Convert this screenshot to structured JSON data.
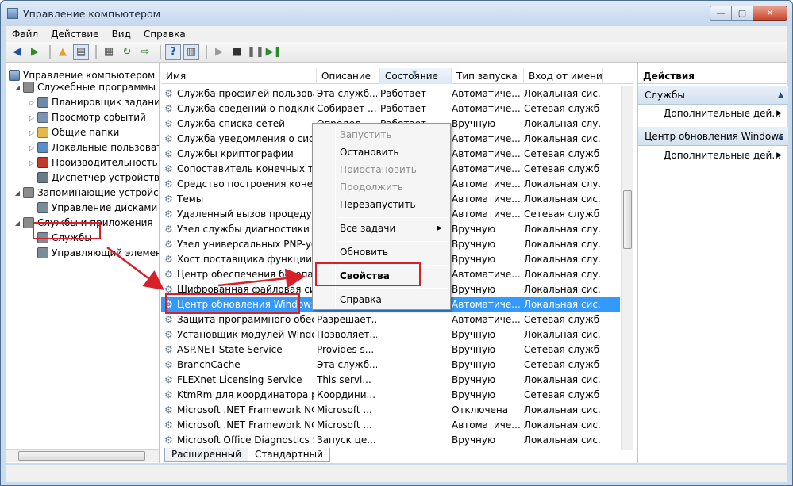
{
  "window": {
    "title": "Управление компьютером",
    "buttons": {
      "minimize": "—",
      "maximize": "▢",
      "close": "✕"
    }
  },
  "menubar": [
    "Файл",
    "Действие",
    "Вид",
    "Справка"
  ],
  "tree": {
    "root": "Управление компьютером (л",
    "items": [
      {
        "label": "Служебные программы",
        "level": 1,
        "expanded": true,
        "icon": "tools-icon",
        "color": "#8c8c8c"
      },
      {
        "label": "Планировщик заданий",
        "level": 2,
        "expanded": false,
        "icon": "clock-icon",
        "color": "#6f8aa8"
      },
      {
        "label": "Просмотр событий",
        "level": 2,
        "expanded": false,
        "icon": "event-viewer-icon",
        "color": "#7a95b6"
      },
      {
        "label": "Общие папки",
        "level": 2,
        "expanded": false,
        "icon": "shared-folder-icon",
        "color": "#e3b94a"
      },
      {
        "label": "Локальные пользовате",
        "level": 2,
        "expanded": false,
        "icon": "users-icon",
        "color": "#5d8cc7"
      },
      {
        "label": "Производительность",
        "level": 2,
        "expanded": false,
        "icon": "performance-icon",
        "color": "#c0392b"
      },
      {
        "label": "Диспетчер устройств",
        "level": 2,
        "expanded": null,
        "icon": "device-manager-icon",
        "color": "#6a7a8a"
      },
      {
        "label": "Запоминающие устройст",
        "level": 1,
        "expanded": true,
        "icon": "storage-icon",
        "color": "#8c8c8c"
      },
      {
        "label": "Управление дисками",
        "level": 2,
        "expanded": null,
        "icon": "disk-icon",
        "color": "#7d8b99"
      },
      {
        "label": "Службы и приложения",
        "level": 1,
        "expanded": true,
        "icon": "services-apps-icon",
        "color": "#8c8c8c"
      },
      {
        "label": "Службы",
        "level": 2,
        "expanded": null,
        "icon": "services-icon",
        "color": "#7d8b99"
      },
      {
        "label": "Управляющий элемен",
        "level": 2,
        "expanded": null,
        "icon": "wmi-control-icon",
        "color": "#7d8b99"
      }
    ]
  },
  "columns": [
    "Имя",
    "Описание",
    "Состояние",
    "Тип запуска",
    "Вход от имени"
  ],
  "services": [
    [
      "Служба профилей пользоват...",
      "Эта служб...",
      "Работает",
      "Автоматиче...",
      "Локальная сис..."
    ],
    [
      "Служба сведений о подключ...",
      "Собирает ...",
      "Работает",
      "Автоматиче...",
      "Сетевая служба"
    ],
    [
      "Служба списка сетей",
      "Определ...",
      "Работает",
      "Вручную",
      "Локальная слу..."
    ],
    [
      "Служба уведомления о систе...",
      "",
      "",
      "Автоматиче...",
      "Локальная сис..."
    ],
    [
      "Службы криптографии",
      "",
      "",
      "Автоматиче...",
      "Сетевая служба"
    ],
    [
      "Сопоставитель конечных точ...",
      "",
      "",
      "Автоматиче...",
      "Сетевая служба"
    ],
    [
      "Средство построения конечн...",
      "",
      "",
      "Автоматиче...",
      "Локальная слу..."
    ],
    [
      "Темы",
      "",
      "",
      "Автоматиче...",
      "Локальная сис..."
    ],
    [
      "Удаленный вызов процедур (...",
      "",
      "",
      "Автоматиче...",
      "Сетевая служба"
    ],
    [
      "Узел службы диагностики",
      "",
      "",
      "Вручную",
      "Локальная слу..."
    ],
    [
      "Узел универсальных PNP-уст...",
      "",
      "",
      "Вручную",
      "Локальная слу..."
    ],
    [
      "Хост поставщика функции о...",
      "",
      "",
      "Вручную",
      "Локальная слу..."
    ],
    [
      "Центр обеспечения безопас...",
      "",
      "",
      "Автоматиче...",
      "Локальная слу..."
    ],
    [
      "Шифрованная файловая сис...",
      "",
      "",
      "Вручную",
      "Локальная сис..."
    ],
    [
      "Центр обновления Windows",
      "",
      "",
      "Автоматиче...",
      "Локальная сис..."
    ],
    [
      "Защита программного обес...",
      "Разрешает...",
      "",
      "Автоматиче...",
      "Сетевая служба"
    ],
    [
      "Установщик модулей Windows",
      "Позволяет...",
      "",
      "Вручную",
      "Локальная сис..."
    ],
    [
      "ASP.NET State Service",
      "Provides s...",
      "",
      "Вручную",
      "Сетевая служба"
    ],
    [
      "BranchCache",
      "Эта служб...",
      "",
      "Вручную",
      "Сетевая служба"
    ],
    [
      "FLEXnet Licensing Service",
      "This servi...",
      "",
      "Вручную",
      "Локальная сис..."
    ],
    [
      "KtmRm для координатора ра...",
      "Координи...",
      "",
      "Вручную",
      "Сетевая служба"
    ],
    [
      "Microsoft .NET Framework NG...",
      "Microsoft ...",
      "",
      "Отключена",
      "Локальная сис..."
    ],
    [
      "Microsoft .NET Framework NG...",
      "Microsoft ...",
      "",
      "Автоматиче...",
      "Локальная сис..."
    ],
    [
      "Microsoft Office Diagnostics S...",
      "Запуск це...",
      "",
      "Вручную",
      "Локальная сис..."
    ]
  ],
  "selected_index": 14,
  "tabs": [
    "Расширенный",
    "Стандартный"
  ],
  "actions": {
    "title": "Действия",
    "sections": [
      {
        "label": "Службы",
        "item": "Дополнительные дей..."
      },
      {
        "label": "Центр обновления Windows",
        "item": "Дополнительные дей..."
      }
    ]
  },
  "context_menu": [
    {
      "label": "Запустить",
      "disabled": true
    },
    {
      "label": "Остановить",
      "disabled": false
    },
    {
      "label": "Приостановить",
      "disabled": true
    },
    {
      "label": "Продолжить",
      "disabled": true
    },
    {
      "label": "Перезапустить",
      "disabled": false
    },
    {
      "label": "Все задачи",
      "disabled": false,
      "submenu": true
    },
    {
      "label": "Обновить",
      "disabled": false
    },
    {
      "label": "Свойства",
      "disabled": false,
      "bold": true
    },
    {
      "label": "Справка",
      "disabled": false
    }
  ],
  "colors": {
    "highlight": "#d6202a",
    "selection": "#3399ff",
    "frame": "#c9dcee"
  }
}
